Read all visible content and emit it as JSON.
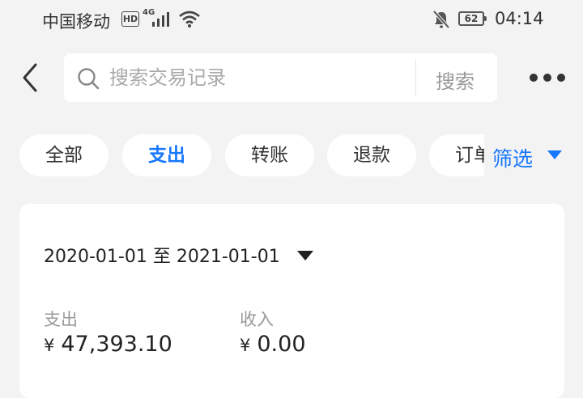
{
  "status_bar": {
    "carrier": "中国移动",
    "hd": "HD",
    "network": "4G",
    "battery": "62",
    "time": "04:14"
  },
  "header": {
    "search_placeholder": "搜索交易记录",
    "search_button": "搜索"
  },
  "filters": {
    "chips": [
      "全部",
      "支出",
      "转账",
      "退款",
      "订单"
    ],
    "active": "支出",
    "filter_label": "筛选"
  },
  "summary": {
    "date_start": "2020-01-01",
    "date_sep": "至",
    "date_end": "2021-01-01",
    "expense_label": "支出",
    "expense_currency": "¥",
    "expense_value": "47,393.10",
    "income_label": "收入",
    "income_currency": "¥",
    "income_value": "0.00"
  },
  "colors": {
    "accent": "#1677ff",
    "background": "#f3f3f3",
    "card": "#ffffff"
  },
  "icons": [
    "back-arrow-icon",
    "search-icon",
    "more-icon",
    "caret-down-icon",
    "signal-icon",
    "wifi-icon",
    "mute-bell-icon",
    "battery-icon"
  ]
}
